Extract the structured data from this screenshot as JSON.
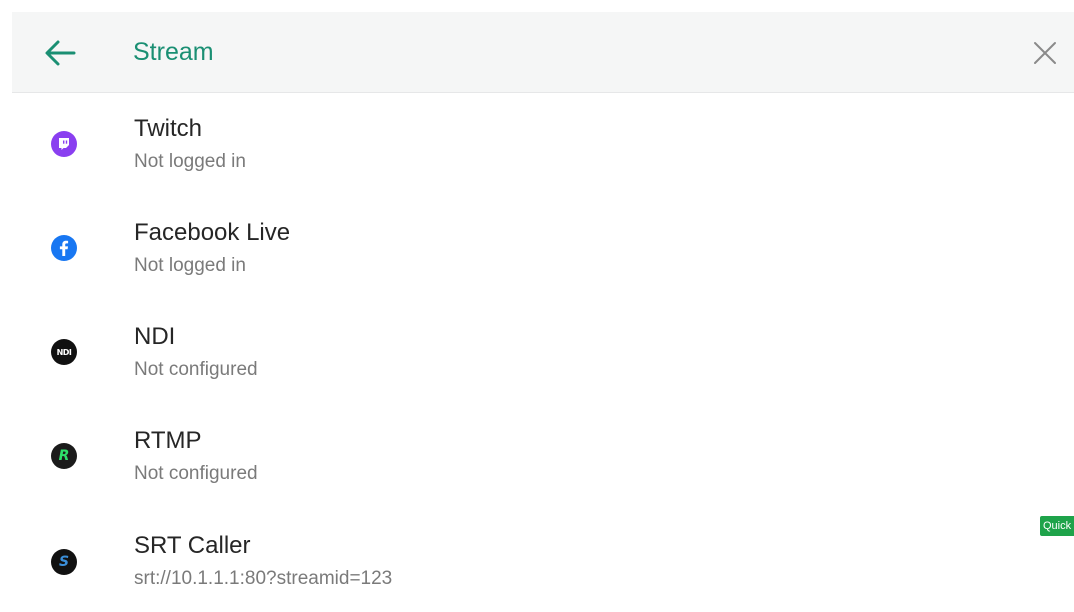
{
  "header": {
    "title": "Stream",
    "back_icon": "arrow-left-icon",
    "close_icon": "close-icon",
    "accent_color": "#1a8f73"
  },
  "services": [
    {
      "name": "Twitch",
      "status": "Not logged in",
      "icon": "twitch-icon",
      "icon_color": "#8a3ff0"
    },
    {
      "name": "Facebook Live",
      "status": "Not logged in",
      "icon": "facebook-icon",
      "icon_color": "#1877f2"
    },
    {
      "name": "NDI",
      "status": "Not configured",
      "icon": "ndi-icon",
      "icon_color": "#111111",
      "icon_text": "NDI"
    },
    {
      "name": "RTMP",
      "status": "Not configured",
      "icon": "rtmp-icon",
      "icon_color": "#1b1b1b",
      "icon_text": "R"
    },
    {
      "name": "SRT Caller",
      "status": "srt://10.1.1.1:80?streamid=123",
      "icon": "srt-icon",
      "icon_color": "#111111",
      "icon_text": "S"
    }
  ],
  "quick_badge": {
    "label": "Quick",
    "color": "#1ea34a"
  }
}
